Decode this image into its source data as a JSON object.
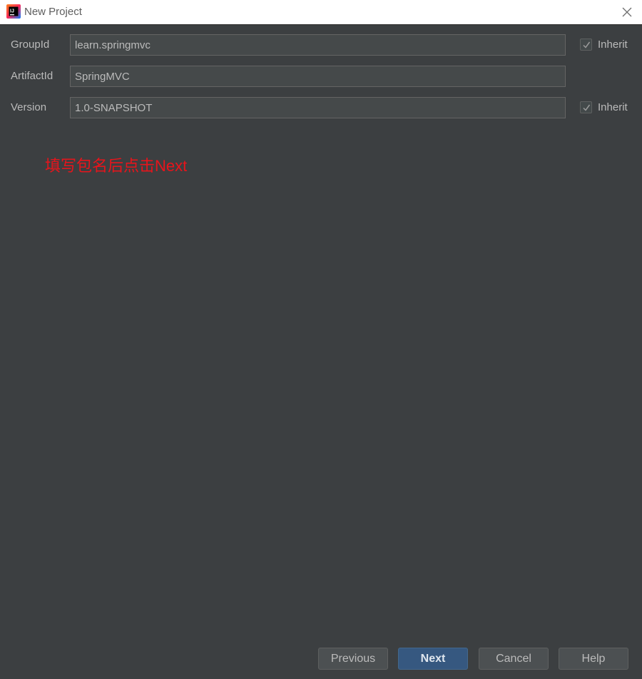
{
  "window": {
    "title": "New Project"
  },
  "form": {
    "group_id": {
      "label": "GroupId",
      "value": "learn.springmvc",
      "inherit_label": "Inherit",
      "inherit_checked": true
    },
    "artifact_id": {
      "label": "ArtifactId",
      "value": "SpringMVC"
    },
    "version": {
      "label": "Version",
      "value": "1.0-SNAPSHOT",
      "inherit_label": "Inherit",
      "inherit_checked": true
    }
  },
  "annotation": {
    "text": "填写包名后点击Next",
    "color": "#e8141b"
  },
  "buttons": {
    "previous": "Previous",
    "next": "Next",
    "cancel": "Cancel",
    "help": "Help"
  },
  "icons": {
    "app": "intellij-idea-icon",
    "close": "close-icon",
    "check": "checkmark-icon"
  },
  "colors": {
    "background": "#3c3f41",
    "primary_button": "#365880",
    "text": "#bbbbbb"
  }
}
